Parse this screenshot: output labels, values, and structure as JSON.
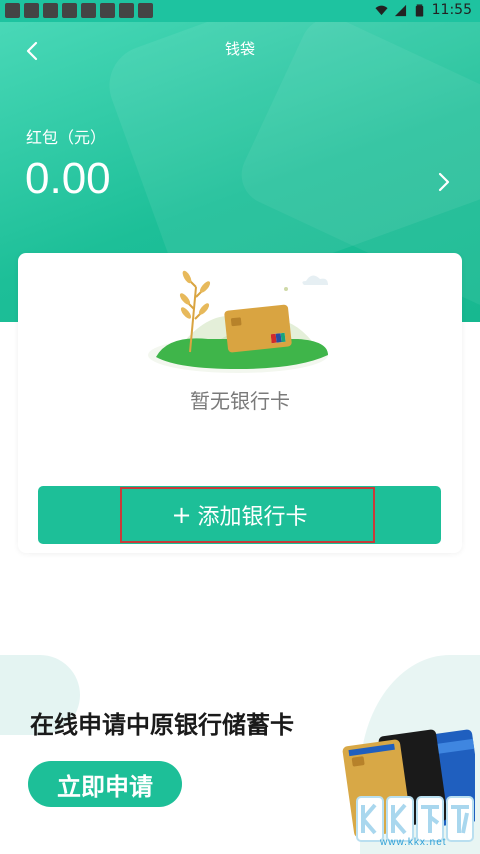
{
  "status_bar": {
    "time": "11:55"
  },
  "header": {
    "title": "钱袋",
    "red_packet_label": "红包（元）",
    "red_packet_amount": "0.00"
  },
  "bank_card": {
    "empty_text": "暂无银行卡",
    "add_button": {
      "plus": "+",
      "label": "添加银行卡"
    }
  },
  "promo": {
    "title": "在线申请中原银行储蓄卡",
    "apply_button": "立即申请"
  },
  "watermark": {
    "site": "www.kkx.net"
  },
  "colors": {
    "primary": "#1dbf98",
    "highlight_border": "#c93a3a"
  }
}
